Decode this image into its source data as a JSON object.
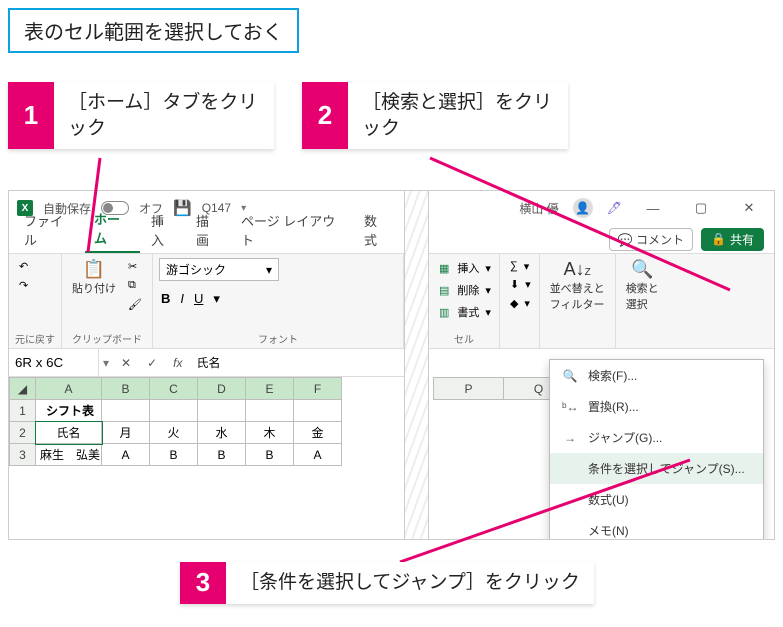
{
  "top_note": "表のセル範囲を選択しておく",
  "callouts": {
    "1": {
      "num": "1",
      "text": "［ホーム］タブをクリック"
    },
    "2": {
      "num": "2",
      "text": "［検索と選択］をクリック"
    },
    "3": {
      "num": "3",
      "text": "［条件を選択してジャンプ］をクリック"
    }
  },
  "titlebar": {
    "autosave_label": "自動保存",
    "autosave_state": "オフ",
    "doc_name": "Q147",
    "user_name": "横山 優"
  },
  "tabs": {
    "file": "ファイル",
    "home": "ホーム",
    "insert": "挿入",
    "draw": "描画",
    "layout": "ページ レイアウト",
    "formulas": "数式"
  },
  "tabs_right": {
    "comment": "コメント",
    "share": "共有"
  },
  "ribbon": {
    "undo_redo_group": "元に戻す",
    "paste": "貼り付け",
    "clipboard_group": "クリップボード",
    "font_name": "游ゴシック",
    "font_group": "フォント",
    "insert": "挿入",
    "delete": "削除",
    "format": "書式",
    "cells_group": "セル",
    "sort_filter": "並べ替えと\nフィルター",
    "find_select": "検索と\n選択"
  },
  "formula_bar": {
    "namebox": "6R x 6C",
    "value": "氏名"
  },
  "columns": [
    "A",
    "B",
    "C",
    "D",
    "E",
    "F"
  ],
  "rows": [
    {
      "n": "1",
      "cells": [
        "シフト表",
        "",
        "",
        "",
        "",
        ""
      ],
      "title_row": true
    },
    {
      "n": "2",
      "cells": [
        "氏名",
        "月",
        "火",
        "水",
        "木",
        "金"
      ],
      "header_row": true
    },
    {
      "n": "3",
      "cells": [
        "麻生　弘美",
        "A",
        "B",
        "B",
        "B",
        "A"
      ]
    }
  ],
  "right_columns": [
    "P",
    "Q"
  ],
  "menu": {
    "find": "検索(F)...",
    "replace": "置換(R)...",
    "goto": "ジャンプ(G)...",
    "gospecial": "条件を選択してジャンプ(S)...",
    "formulas": "数式(U)",
    "notes": "メモ(N)"
  }
}
